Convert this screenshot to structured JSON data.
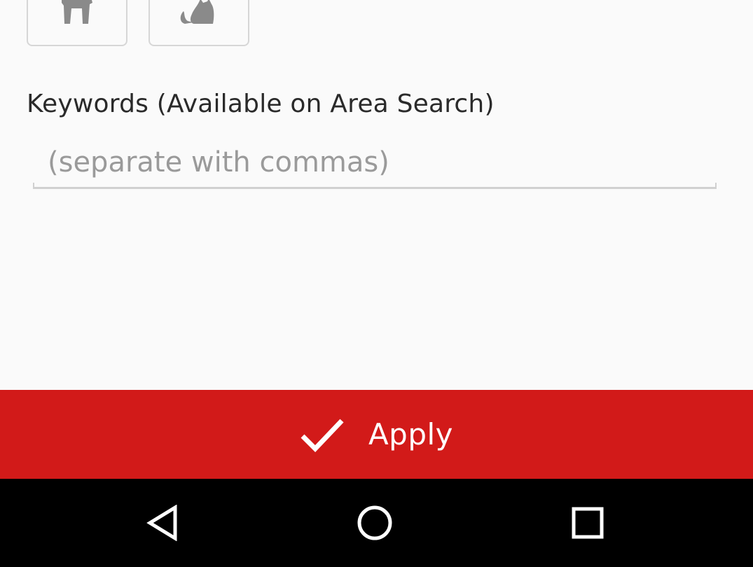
{
  "pet_filter": {
    "dog_icon": "dog-icon",
    "cat_icon": "cat-icon"
  },
  "keywords": {
    "label": "Keywords (Available on Area Search)",
    "placeholder": "(separate with commas)",
    "value": ""
  },
  "apply": {
    "label": "Apply",
    "icon": "checkmark-icon",
    "color": "#d21a19"
  },
  "navigation": {
    "back_icon": "back-icon",
    "home_icon": "home-icon",
    "recents_icon": "recents-icon",
    "color": "#000000"
  }
}
